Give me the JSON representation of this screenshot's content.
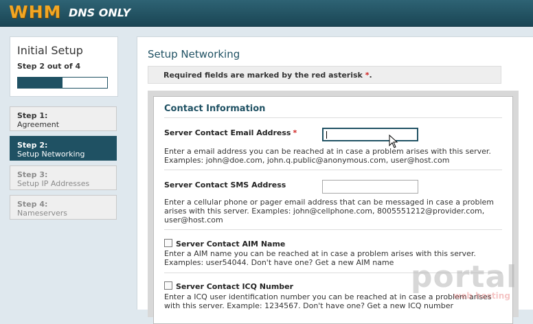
{
  "header": {
    "logo_main": "WHM",
    "logo_sub": "DNS ONLY"
  },
  "sidebar": {
    "title": "Initial Setup",
    "step_text": "Step 2 out of 4",
    "progress_fraction": 0.5,
    "steps": [
      {
        "step": "Step 1:",
        "name": "Agreement",
        "state": "done"
      },
      {
        "step": "Step 2:",
        "name": "Setup Networking",
        "state": "active"
      },
      {
        "step": "Step 3:",
        "name": "Setup IP Addresses",
        "state": "disabled"
      },
      {
        "step": "Step 4:",
        "name": "Nameservers",
        "state": "disabled"
      }
    ]
  },
  "main": {
    "title": "Setup Networking",
    "notice_prefix": "Required fields are marked by the red asterisk ",
    "notice_asterisk": "*",
    "notice_suffix": ".",
    "section_title": "Contact Information",
    "fields": {
      "email": {
        "label": "Server Contact Email Address",
        "required_mark": "*",
        "value": "",
        "description": "Enter a email address you can be reached at in case a problem arises with this server. Examples: john@doe.com, john.q.public@anonymous.com, user@host.com"
      },
      "sms": {
        "label": "Server Contact SMS Address",
        "value": "",
        "description": "Enter a cellular phone or pager email address that can be messaged in case a problem arises with this server. Examples: john@cellphone.com, 8005551212@provider.com, user@host.com"
      },
      "aim": {
        "label": "Server Contact AIM Name",
        "checked": false,
        "description": "Enter a AIM name you can be reached at in case a problem arises with this server. Examples: user54044. Don't have one? Get a new AIM name"
      },
      "icq": {
        "label": "Server Contact ICQ Number",
        "checked": false,
        "description": "Enter a ICQ user identification number you can be reached at in case a problem arises with this server. Example: 1234567. Don't have one? Get a new ICQ number"
      }
    }
  },
  "watermark": {
    "main": "portal",
    "sub": "web hosting"
  },
  "colors": {
    "brand": "#1f5163",
    "logo": "#f2a623",
    "required": "#d0201f"
  }
}
